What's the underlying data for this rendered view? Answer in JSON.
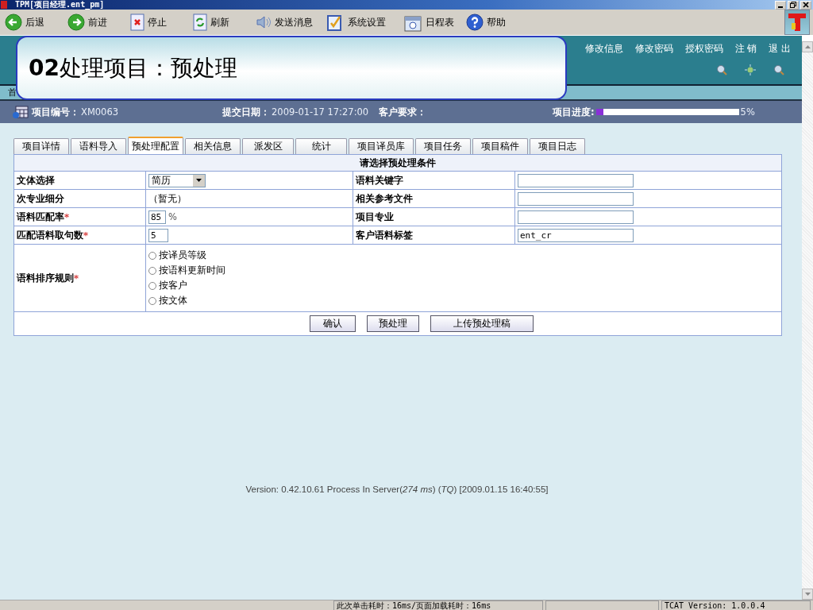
{
  "window": {
    "title": "TPM[项目经理.ent_pm]"
  },
  "toolbar": [
    {
      "kind": "back",
      "label": "后退"
    },
    {
      "kind": "forward",
      "label": "前进"
    },
    {
      "kind": "stop",
      "label": "停止"
    },
    {
      "kind": "refresh",
      "label": "刷新"
    },
    {
      "kind": "message",
      "label": "发送消息"
    },
    {
      "kind": "settings",
      "label": "系统设置"
    },
    {
      "kind": "calendar",
      "label": "日程表"
    },
    {
      "kind": "help",
      "label": "帮助"
    }
  ],
  "callout": {
    "text": "**02**处理项目：预处理"
  },
  "header_links": [
    "修改信息",
    "修改密码",
    "授权密码",
    "注 销",
    "退 出"
  ],
  "nav": {
    "first_item": "首"
  },
  "project_bar": {
    "number_label": "项目编号：",
    "number": "XM0063",
    "date_label": "提交日期：",
    "date": "2009-01-17 17:27:00",
    "request_label": "客户要求：",
    "progress_label": "项目进度:",
    "progress": {
      "level": 0.05,
      "reading": "5%"
    }
  },
  "tabs": [
    {
      "label": "项目详情",
      "selected": false
    },
    {
      "label": "语料导入",
      "selected": false
    },
    {
      "label": "预处理配置",
      "selected": true
    },
    {
      "label": "相关信息",
      "selected": false
    },
    {
      "label": "派发区",
      "selected": false
    },
    {
      "label": "统计",
      "selected": false
    },
    {
      "label": "项目译员库",
      "selected": false
    },
    {
      "label": "项目任务",
      "selected": false
    },
    {
      "label": "项目稿件",
      "selected": false
    },
    {
      "label": "项目日志",
      "selected": false
    }
  ],
  "form": {
    "title": "请选择预处理条件",
    "rows": [
      {
        "label": "文体选择",
        "value": {
          "kind": "select",
          "value": "简历"
        },
        "label2": "语料关键字",
        "value2": {
          "kind": "input"
        }
      },
      {
        "label": "次专业细分",
        "value": {
          "kind": "text",
          "text": "（暂无）"
        },
        "label2": "相关参考文件",
        "value2": {
          "kind": "input"
        }
      },
      {
        "label": "语料匹配率",
        "mark": "*",
        "value": {
          "kind": "input",
          "value": "85",
          "unit": "%"
        },
        "label2": "项目专业",
        "value2": {
          "kind": "input"
        }
      },
      {
        "label": "匹配语料取句数",
        "mark": "*",
        "value": {
          "kind": "input",
          "value": "5"
        },
        "label2": "客户语料标签",
        "value2": {
          "kind": "input",
          "value": "ent_cr"
        }
      }
    ],
    "sort": {
      "label": "语料排序规则",
      "mark": "*",
      "options": [
        {
          "label": "按译员等级",
          "selected": false
        },
        {
          "label": "按语料更新时间",
          "selected": false
        },
        {
          "label": "按客户",
          "selected": false
        },
        {
          "label": "按文体",
          "selected": false
        }
      ]
    },
    "buttons": [
      "确认",
      "预处理",
      "上传预处理稿"
    ]
  },
  "version": "Version: 0.42.10.61 Process In Server(*274 ms*) (*TQ*) [2009.01.15 16:40:55]",
  "status_bar": {
    "timing": "此次单击耗时：16ms/页面加载耗时：16ms",
    "version": "TCAT Version: 1.0.0.4"
  }
}
